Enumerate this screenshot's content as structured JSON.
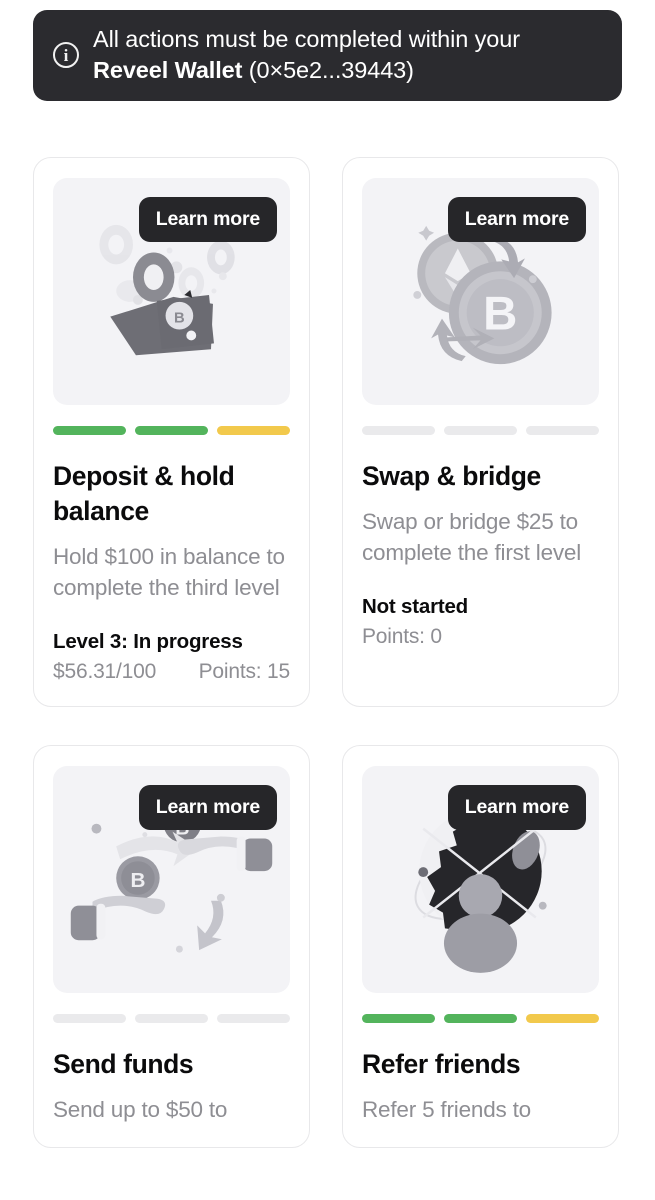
{
  "banner": {
    "icon": "info-circle-icon",
    "line1": "All actions must be completed within your",
    "wallet_name": "Reveel Wallet",
    "wallet_address": " (0×5e2...39443)"
  },
  "cards": [
    {
      "id": "deposit-hold-balance",
      "learn_more_label": "Learn more",
      "illustration": "wallet-with-coins-illustration",
      "progress": [
        "green",
        "green",
        "yellow"
      ],
      "title": "Deposit & hold balance",
      "description": "Hold $100 in balance to complete the third level",
      "status": "Level 3: In progress",
      "amount": "$56.31/100",
      "points": "Points: 15"
    },
    {
      "id": "swap-bridge",
      "learn_more_label": "Learn more",
      "illustration": "eth-btc-swap-coins-illustration",
      "progress": [
        "empty",
        "empty",
        "empty"
      ],
      "title": "Swap & bridge",
      "description": "Swap or bridge $25 to complete the first level",
      "status": "Not started",
      "amount": "",
      "points": "Points: 0"
    },
    {
      "id": "send-funds",
      "learn_more_label": "Learn more",
      "illustration": "hands-exchanging-coin-illustration",
      "progress": [
        "empty",
        "empty",
        "empty"
      ],
      "title": "Send funds",
      "description": "Send up to $50 to",
      "status": "",
      "amount": "",
      "points": ""
    },
    {
      "id": "refer-friends",
      "learn_more_label": "Learn more",
      "illustration": "network-globe-illustration",
      "progress": [
        "green",
        "green",
        "yellow"
      ],
      "title": "Refer friends",
      "description": "Refer 5 friends to",
      "status": "",
      "amount": "",
      "points": ""
    }
  ],
  "colors": {
    "green": "#53b45c",
    "yellow": "#f2c94c",
    "bar_empty": "#eaeaec",
    "dark": "#262629",
    "muted_text": "#8e8e93",
    "card_border": "#e8e8ea",
    "media_bg": "#f3f3f6"
  }
}
